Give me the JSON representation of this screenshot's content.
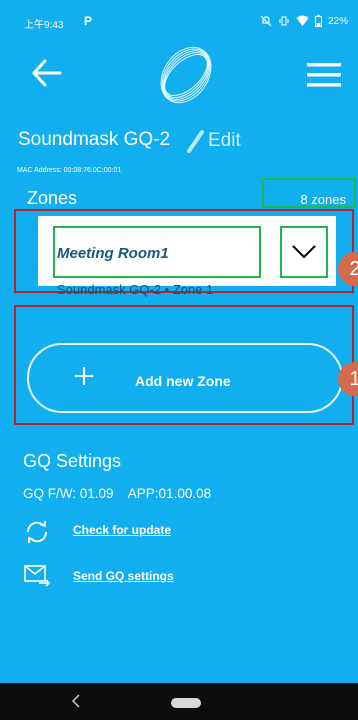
{
  "status_bar": {
    "time": "上午9:43",
    "app_glyph": "P",
    "battery": "22%"
  },
  "header": {
    "back_icon": "arrow-left-icon",
    "logo_icon": "ring-logo-icon",
    "menu_icon": "hamburger-menu-icon"
  },
  "device": {
    "name": "Soundmask GQ-2",
    "edit_label": "Edit",
    "mac_address": "MAC Address: 00:08:76:0C:00:01"
  },
  "zones": {
    "title": "Zones",
    "count": "8 zones",
    "items": [
      {
        "name": "Meeting Room1",
        "subtitle": "Soundmask GQ-2 • Zone 1"
      }
    ],
    "add_label": "Add new Zone"
  },
  "annotations": {
    "badge_2": "2",
    "badge_1": "1"
  },
  "gq_settings": {
    "title": "GQ Settings",
    "versions": "GQ F/W: 01.09    APP:01.00.08",
    "check_update": "Check for update",
    "send_settings": "Send GQ settings"
  },
  "nav_bar": {
    "back_glyph": "‹"
  },
  "colors": {
    "background": "#11aef0",
    "annotation_red": "#b3262e",
    "annotation_green": "#1fb84a",
    "badge": "#d36a4e"
  }
}
